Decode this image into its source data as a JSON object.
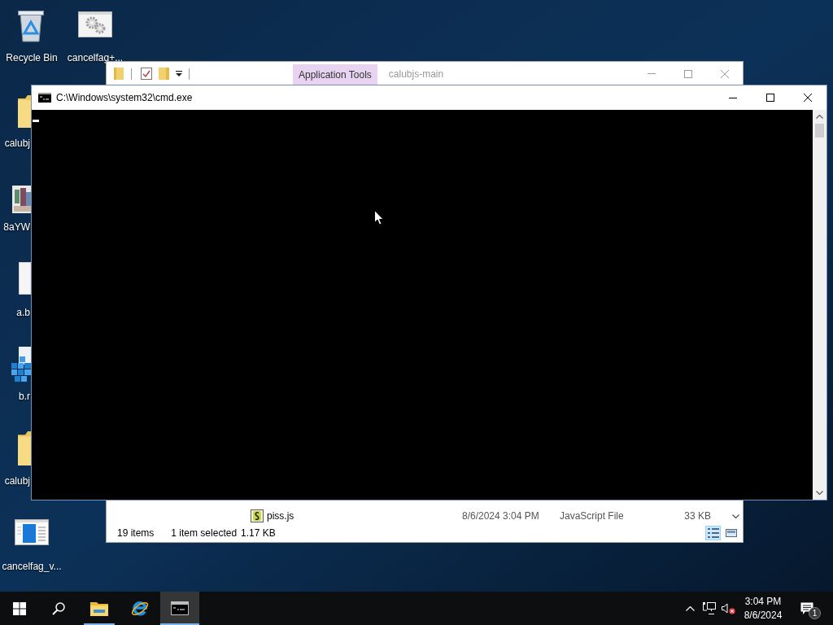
{
  "desktop_icons": [
    {
      "kind": "recycle-bin",
      "label": "Recycle Bin"
    },
    {
      "kind": "settings-file",
      "label": "cancelfag+..."
    },
    {
      "kind": "folder",
      "label": "calubj"
    },
    {
      "kind": "image",
      "label": "8aYW"
    },
    {
      "kind": "file",
      "label": "a.b"
    },
    {
      "kind": "registry",
      "label": "b.r"
    },
    {
      "kind": "folder",
      "label": "calubj"
    },
    {
      "kind": "document",
      "label": "cancelfag_v..."
    }
  ],
  "explorer_window": {
    "context_tab": "Application Tools",
    "title": "calubjs-main",
    "rows": [
      {
        "name": "piss.js",
        "date_modified": "8/6/2024 3:04 PM",
        "type": "JavaScript File",
        "size": "33 KB"
      }
    ],
    "status_bar": {
      "item_count": "19 items",
      "selection": "1 item selected",
      "selection_size": "1.17 KB"
    },
    "view_buttons": [
      {
        "kind": "details",
        "selected": true
      },
      {
        "kind": "large-icons",
        "selected": false
      }
    ]
  },
  "cmd_window": {
    "title": "C:\\Windows\\system32\\cmd.exe"
  },
  "taskbar": {
    "apps": [
      {
        "kind": "file-explorer",
        "running": true,
        "active": false
      },
      {
        "kind": "internet-explorer",
        "running": false,
        "active": false
      },
      {
        "kind": "cmd",
        "running": true,
        "active": true
      }
    ],
    "clock": {
      "time": "3:04 PM",
      "date": "8/6/2024"
    },
    "notification_count": "1"
  }
}
